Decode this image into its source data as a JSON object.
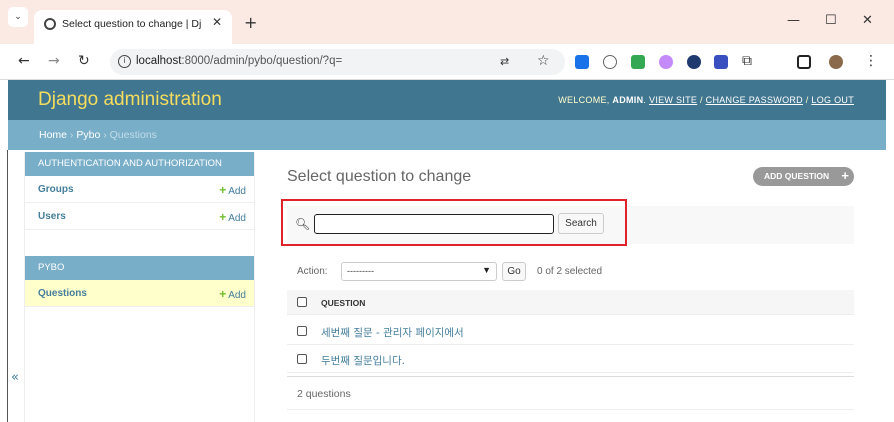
{
  "browser": {
    "tab_title": "Select question to change | Dj",
    "tab_close": "✕",
    "new_tab": "+",
    "url_host": "localhost",
    "url_path": ":8000/admin/pybo/question/?q=",
    "win_min": "—",
    "win_max": "☐",
    "win_close": "✕"
  },
  "header": {
    "branding": "Django administration",
    "welcome": "WELCOME, ",
    "username": "ADMIN",
    "view_site": "VIEW SITE",
    "change_password": "CHANGE PASSWORD",
    "logout": "LOG OUT",
    "separator": " / "
  },
  "breadcrumbs": {
    "home": "Home",
    "app": "Pybo",
    "current": "Questions",
    "sep": " › "
  },
  "sidebar": {
    "auth_caption": "Authentication and Authorization",
    "auth_items": [
      {
        "name": "Groups",
        "add": "Add"
      },
      {
        "name": "Users",
        "add": "Add"
      }
    ],
    "pybo_caption": "Pybo",
    "pybo_items": [
      {
        "name": "Questions",
        "add": "Add"
      }
    ],
    "toggle": "«"
  },
  "content": {
    "title": "Select question to change",
    "add_button": "ADD QUESTION",
    "search_value": "",
    "search_button": "Search",
    "action_label": "Action:",
    "action_selected": "---------",
    "go_button": "Go",
    "selected_count": "0 of 2 selected",
    "column_header": "QUESTION",
    "rows": [
      "세번째 질문 - 관리자 페이지에서",
      "두번째 질문입니다."
    ],
    "paginator": "2 questions"
  },
  "colors": {
    "header_bg": "#417690",
    "breadcrumb_bg": "#79aec8",
    "branding": "#f5dd5d",
    "link": "#447e9b",
    "highlight_box": "#e0232a",
    "add_plus": "#70bf2b"
  }
}
